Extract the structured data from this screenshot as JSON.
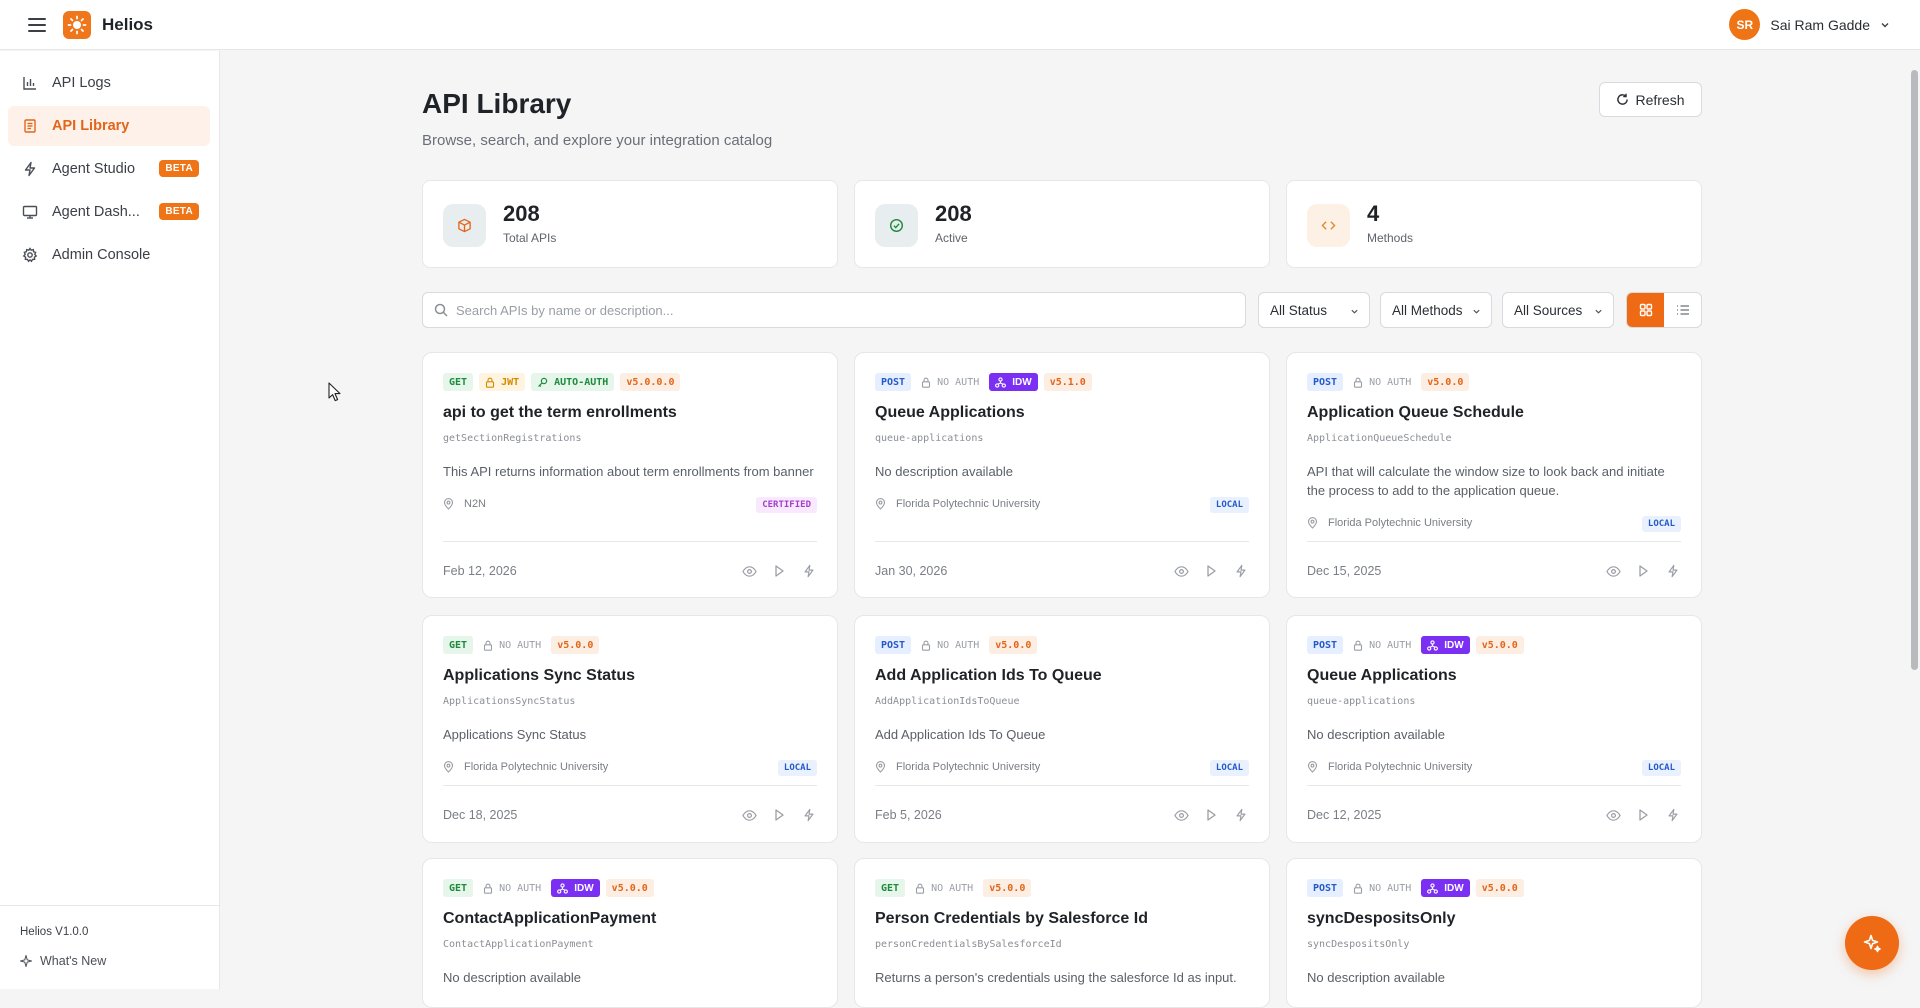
{
  "app": {
    "name": "Helios",
    "version": "Helios V1.0.0",
    "whats_new": "What's New",
    "accent": "#ee6a14"
  },
  "user": {
    "initials": "SR",
    "name": "Sai Ram Gadde"
  },
  "sidebar": {
    "items": [
      {
        "label": "API Logs",
        "icon": "bar-chart-icon"
      },
      {
        "label": "API Library",
        "icon": "book-icon",
        "active": true
      },
      {
        "label": "Agent Studio",
        "icon": "lightning-icon",
        "badge": "BETA"
      },
      {
        "label": "Agent Dash...",
        "icon": "monitor-icon",
        "badge": "BETA"
      },
      {
        "label": "Admin Console",
        "icon": "gear-icon"
      }
    ]
  },
  "header": {
    "title": "API Library",
    "subtitle": "Browse, search, and explore your integration catalog",
    "refresh_label": "Refresh"
  },
  "stats": [
    {
      "value": "208",
      "label": "Total APIs",
      "icon": "cube-icon",
      "color": "#e2661a"
    },
    {
      "value": "208",
      "label": "Active",
      "icon": "check-circle-icon",
      "color": "#1d8a3c"
    },
    {
      "value": "4",
      "label": "Methods",
      "icon": "code-icon",
      "color": "#e28a2a"
    }
  ],
  "filters": {
    "search_placeholder": "Search APIs by name or description...",
    "status": "All Status",
    "methods": "All Methods",
    "sources": "All Sources"
  },
  "cards": [
    {
      "method": "GET",
      "auth": [
        "JWT",
        "AUTO-AUTH"
      ],
      "idw": false,
      "version": "v5.0.0.0",
      "title": "api to get the term enrollments",
      "slug": "getSectionRegistrations",
      "desc": "This API returns information about term enrollments from banner",
      "source": "N2N",
      "tag": "CERTIFIED",
      "date": "Feb 12, 2026"
    },
    {
      "method": "POST",
      "auth": [
        "NO AUTH"
      ],
      "idw": true,
      "version": "v5.1.0",
      "title": "Queue Applications",
      "slug": "queue-applications",
      "desc": "No description available",
      "source": "Florida Polytechnic University",
      "tag": "LOCAL",
      "date": "Jan 30, 2026"
    },
    {
      "method": "POST",
      "auth": [
        "NO AUTH"
      ],
      "idw": false,
      "version": "v5.0.0",
      "title": "Application Queue Schedule",
      "slug": "ApplicationQueueSchedule",
      "desc": "API that will calculate the window size to look back and initiate the process to add to the application queue.",
      "source": "Florida Polytechnic University",
      "tag": "LOCAL",
      "date": "Dec 15, 2025"
    },
    {
      "method": "GET",
      "auth": [
        "NO AUTH"
      ],
      "idw": false,
      "version": "v5.0.0",
      "title": "Applications Sync Status",
      "slug": "ApplicationsSyncStatus",
      "desc": "Applications Sync Status",
      "source": "Florida Polytechnic University",
      "tag": "LOCAL",
      "date": "Dec 18, 2025"
    },
    {
      "method": "POST",
      "auth": [
        "NO AUTH"
      ],
      "idw": false,
      "version": "v5.0.0",
      "title": "Add Application Ids To Queue",
      "slug": "AddApplicationIdsToQueue",
      "desc": "Add Application Ids To Queue",
      "source": "Florida Polytechnic University",
      "tag": "LOCAL",
      "date": "Feb 5, 2026"
    },
    {
      "method": "POST",
      "auth": [
        "NO AUTH"
      ],
      "idw": true,
      "version": "v5.0.0",
      "title": "Queue Applications",
      "slug": "queue-applications",
      "desc": "No description available",
      "source": "Florida Polytechnic University",
      "tag": "LOCAL",
      "date": "Dec 12, 2025"
    },
    {
      "method": "GET",
      "auth": [
        "NO AUTH"
      ],
      "idw": true,
      "version": "v5.0.0",
      "title": "ContactApplicationPayment",
      "slug": "ContactApplicationPayment",
      "desc": "No description available",
      "source": "",
      "tag": "",
      "date": ""
    },
    {
      "method": "GET",
      "auth": [
        "NO AUTH"
      ],
      "idw": false,
      "version": "v5.0.0",
      "title": "Person Credentials by Salesforce Id",
      "slug": "personCredentialsBySalesforceId",
      "desc": "Returns a person's credentials using the salesforce Id as input.",
      "source": "",
      "tag": "",
      "date": ""
    },
    {
      "method": "POST",
      "auth": [
        "NO AUTH"
      ],
      "idw": true,
      "version": "v5.0.0",
      "title": "syncDespositsOnly",
      "slug": "syncDespositsOnly",
      "desc": "No description available",
      "source": "",
      "tag": "",
      "date": ""
    }
  ],
  "idw_label": "IDW"
}
